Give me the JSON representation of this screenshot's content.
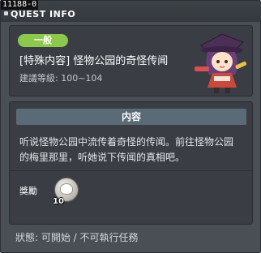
{
  "window": {
    "id_tag": "11188-0",
    "title": "QUEST INFO"
  },
  "quest": {
    "category": "一般",
    "title": "[特殊内容] 怪物公园的奇怪传闻",
    "recommended_level": "建議等級: 100~104"
  },
  "content": {
    "tab_label": "内容",
    "description_lines": [
      "听说怪物公园中流传着奇怪的传闻。前往怪物公园",
      "的梅里那里，听她说下传闻的真相吧。"
    ]
  },
  "reward": {
    "label": "獎勵",
    "item_icon": "shell-coin-icon",
    "quantity": "10"
  },
  "status": {
    "text": "狀態: 可開始 / 不可執行任務"
  },
  "colors": {
    "window_bg": "#4a4f55",
    "panel_bg": "#3a3e44",
    "badge_green": "#8cc84b",
    "tab_bg": "#5a6a76"
  }
}
